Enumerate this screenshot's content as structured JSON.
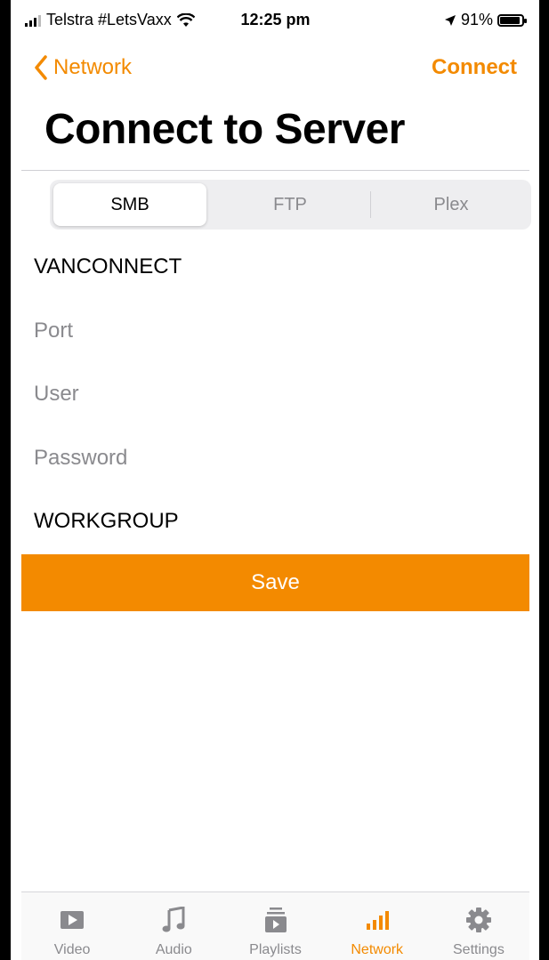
{
  "status_bar": {
    "carrier": "Telstra #LetsVaxx",
    "time": "12:25 pm",
    "battery": "91%"
  },
  "nav": {
    "back_label": "Network",
    "action_label": "Connect"
  },
  "page_title": "Connect to Server",
  "segments": [
    "SMB",
    "FTP",
    "Plex"
  ],
  "selected_segment": "SMB",
  "form": {
    "server": "VANCONNECT",
    "port_placeholder": "Port",
    "user_placeholder": "User",
    "password_placeholder": "Password",
    "workgroup": "WORKGROUP"
  },
  "save_label": "Save",
  "tabs": [
    {
      "label": "Video",
      "icon": "video-icon"
    },
    {
      "label": "Audio",
      "icon": "music-note-icon"
    },
    {
      "label": "Playlists",
      "icon": "playlist-icon"
    },
    {
      "label": "Network",
      "icon": "network-bars-icon"
    },
    {
      "label": "Settings",
      "icon": "gear-icon"
    }
  ],
  "colors": {
    "accent": "#f38a00"
  }
}
